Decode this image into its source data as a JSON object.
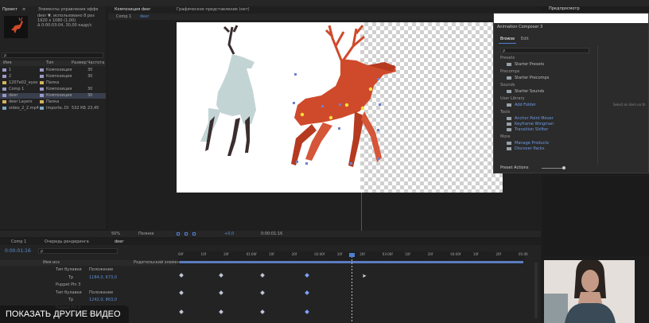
{
  "project": {
    "tab_project": "Проект",
    "tab_effects": "Элементы управления эффе",
    "tab_menu": "≡",
    "info_name": "deer ▼, использовано 8 раз",
    "info_size": "1920 x 1080 (1,00)",
    "info_dur": "Δ 0:00:03:04, 30,00 кадр/с",
    "search_placeholder": "ρ",
    "headers": {
      "name": "Имя",
      "type": "Тип",
      "size": "Размер",
      "fps": "Частота"
    },
    "items": [
      {
        "name": "1",
        "type": "Композиция",
        "size": "",
        "fps": "30",
        "color": "#9a9ac9"
      },
      {
        "name": "2",
        "type": "Композиция",
        "size": "",
        "fps": "30",
        "color": "#9a9ac9"
      },
      {
        "name": "1207e02_eyes",
        "type": "Папка",
        "size": "",
        "fps": "",
        "color": "#d4b35a"
      },
      {
        "name": "Comp 1",
        "type": "Композиция",
        "size": "",
        "fps": "30",
        "color": "#9a9ac9"
      },
      {
        "name": "deer",
        "type": "Композиция",
        "size": "",
        "fps": "30",
        "color": "#9a9ac9"
      },
      {
        "name": "deer Layers",
        "type": "Папка",
        "size": "",
        "fps": "",
        "color": "#d4b35a"
      },
      {
        "name": "video_2_2.mp4",
        "type": "Importe..DI",
        "size": "532 КБ",
        "fps": "23,45",
        "color": "#7fa8c4"
      }
    ]
  },
  "top_tabs": [
    "Композиция deer",
    "Графическое представление (нет)"
  ],
  "comp_tabs": [
    "Comp 1",
    "deer"
  ],
  "viewer_bar": {
    "zoom": "50%",
    "quality": "Полное",
    "exposure": "+0,0",
    "time": "0:00:01:16"
  },
  "timeline": {
    "tab_comp": "Comp 1",
    "tab_queue": "Очередь рендеринга",
    "tab_deer": "deer",
    "current_time": "0:00:01:16",
    "search_placeholder": "ρ",
    "header_name": "Имя исх",
    "header_parent": "Родительский элемент",
    "ruler": [
      "00f",
      "10f",
      "20f",
      "01:00f",
      "10f",
      "20f",
      "02:00f",
      "10f",
      "20f",
      "03:00f",
      "10f",
      "20f",
      "04:00f",
      "10f",
      "20f",
      "05:00"
    ],
    "rows": [
      {
        "label": "Тип булавки",
        "value": "Положение",
        "indent": 1
      },
      {
        "label": "Тр",
        "value": "1184,0, 673,0",
        "indent": 2
      },
      {
        "label": "Puppet Pin 3",
        "value": "",
        "indent": 1
      },
      {
        "label": "Тип булавки",
        "value": "Положение",
        "indent": 1
      },
      {
        "label": "Тр",
        "value": "1242,0, 863,0",
        "indent": 2
      },
      {
        "label": "Puppet Pin 2",
        "value": "",
        "indent": 1
      },
      {
        "label": "Тип булавки",
        "value": "Положение",
        "indent": 1
      }
    ]
  },
  "animation_composer": {
    "title": "Animation Composer 3",
    "tab_browser": "Browse",
    "tab_edit": "Edit",
    "top_tab": "Предпросмотр",
    "sections": [
      {
        "heading": "Presets",
        "items": [
          "Starter Presets"
        ]
      },
      {
        "heading": "Precomps",
        "items": [
          "Starter Precomps"
        ]
      },
      {
        "heading": "Sounds",
        "items": [
          "Starter Sounds"
        ]
      },
      {
        "heading": "User Library",
        "items": [
          "Add Folder"
        ]
      },
      {
        "heading": "Tools",
        "items": [
          "Anchor Point Mover",
          "Keyframe Wingman",
          "Transition Shifter"
        ]
      },
      {
        "heading": "More",
        "items": [
          "Manage Products",
          "Discover Packs"
        ]
      }
    ],
    "right_hint": "Select an item on th",
    "footer": "Preset Actions"
  },
  "overlay": {
    "more_videos": "ПОКАЗАТЬ ДРУГИЕ ВИДЕО"
  },
  "colors": {
    "deer_red": "#cf4a2b",
    "deer_light": "#c3d4d5",
    "antler_dark": "#3a2e2f",
    "accent_blue": "#4c7fd4",
    "key_yellow": "#f5e03a"
  }
}
